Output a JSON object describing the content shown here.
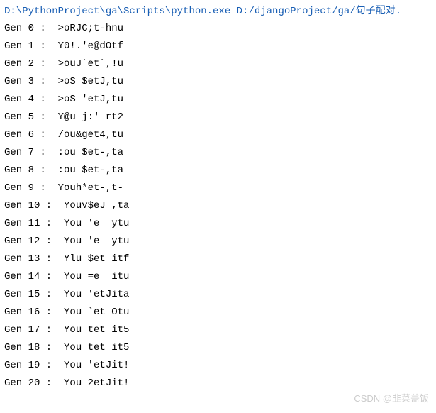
{
  "command": "D:\\PythonProject\\ga\\Scripts\\python.exe D:/djangoProject/ga/句子配对.",
  "output": [
    "Gen 0 :  >oRJC;t-hnu",
    "Gen 1 :  Y0!.'e@dOtf",
    "Gen 2 :  >ouJ`et`,!u",
    "Gen 3 :  >oS $etJ,tu",
    "Gen 4 :  >oS 'etJ,tu",
    "Gen 5 :  Y@u j:' rt2",
    "Gen 6 :  /ou&get4,tu",
    "Gen 7 :  :ou $et-,ta",
    "Gen 8 :  :ou $et-,ta",
    "Gen 9 :  Youh*et-,t-",
    "Gen 10 :  Youv$eJ ,ta",
    "Gen 11 :  You 'e  ytu",
    "Gen 12 :  You 'e  ytu",
    "Gen 13 :  Ylu $et itf",
    "Gen 14 :  You =e  itu",
    "Gen 15 :  You 'etJita",
    "Gen 16 :  You `et Otu",
    "Gen 17 :  You tet it5",
    "Gen 18 :  You tet it5",
    "Gen 19 :  You 'etJit!",
    "Gen 20 :  You 2etJit!"
  ],
  "watermark": "CSDN @韭菜盖饭"
}
